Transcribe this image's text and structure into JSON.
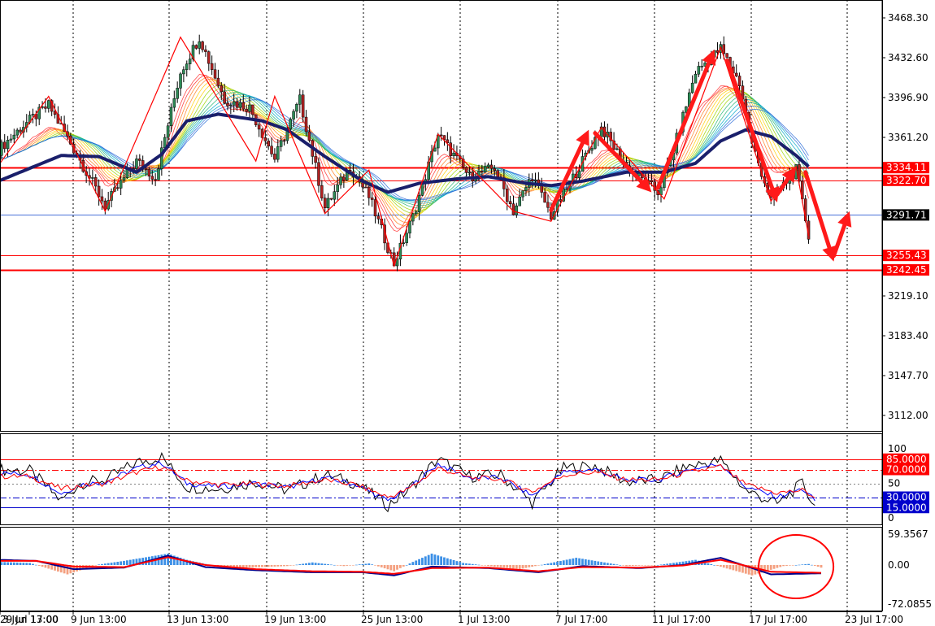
{
  "chart_data": [
    {
      "type": "candlestick",
      "panel": "price",
      "ylim": [
        3095,
        3480
      ],
      "yticks": [
        3468.3,
        3432.6,
        3396.9,
        3361.2,
        3325.5,
        3289.8,
        3254.1,
        3219.1,
        3183.4,
        3147.7,
        3112.0
      ],
      "ytick_labels": [
        "3468.30",
        "3432.60",
        "3396.90",
        "3361.20",
        "",
        "",
        "",
        "3219.10",
        "3183.40",
        "3147.70",
        "3112.00"
      ],
      "x_labels": [
        "3 Jun 13:00",
        "9 Jun 13:00",
        "13 Jun 13:00",
        "19 Jun 13:00",
        "25 Jun 13:00",
        "1 Jul 13:00",
        "7 Jul 17:00",
        "11 Jul 17:00",
        "17 Jul 17:00",
        "23 Jul 17:00",
        "29 Jul 17:00"
      ],
      "price_path": {
        "index": [
          0,
          8,
          16,
          22,
          34,
          44,
          50,
          58,
          64,
          72,
          80,
          88,
          96,
          104,
          112,
          118,
          126,
          132,
          140,
          150,
          158,
          164,
          170,
          176,
          184,
          192,
          200,
          210,
          214,
          222,
          230,
          236,
          240,
          246,
          254,
          258
        ],
        "price": [
          3350,
          3372,
          3390,
          3361,
          3300,
          3340,
          3325,
          3420,
          3451,
          3395,
          3388,
          3342,
          3395,
          3298,
          3335,
          3308,
          3248,
          3290,
          3364,
          3326,
          3334,
          3295,
          3327,
          3291,
          3330,
          3370,
          3335,
          3312,
          3340,
          3420,
          3441,
          3410,
          3355,
          3305,
          3332,
          3273
        ]
      },
      "moving_average": {
        "name": "",
        "index": [
          0,
          20,
          32,
          44,
          52,
          60,
          70,
          84,
          92,
          104,
          116,
          124,
          134,
          146,
          156,
          168,
          176,
          186,
          200,
          212,
          222,
          230,
          238,
          246,
          254,
          258
        ],
        "price": [
          3322,
          3345,
          3344,
          3330,
          3346,
          3376,
          3382,
          3376,
          3368,
          3344,
          3322,
          3312,
          3320,
          3324,
          3326,
          3320,
          3318,
          3322,
          3330,
          3330,
          3338,
          3358,
          3368,
          3362,
          3345,
          3335
        ]
      },
      "horizontal_levels": [
        {
          "value": 3334.11,
          "label": "3334.11",
          "color": "#ff0000",
          "style": "solid-thick"
        },
        {
          "value": 3322.7,
          "label": "3322.70",
          "color": "#ff0000",
          "style": "solid"
        },
        {
          "value": 3291.71,
          "label": "3291.71",
          "color": "#4a72d8",
          "style": "bid"
        },
        {
          "value": 3255.43,
          "label": "3255.43",
          "color": "#ff0000",
          "style": "solid"
        },
        {
          "value": 3242.45,
          "label": "3242.45",
          "color": "#ff0000",
          "style": "solid-thick"
        }
      ],
      "zigzag": {
        "color": "#ff0000",
        "index": [
          0,
          16,
          34,
          58,
          82,
          88,
          104,
          118,
          126,
          140,
          164,
          176,
          192,
          212,
          230,
          246,
          254,
          258
        ],
        "price": [
          3336,
          3398,
          3295,
          3451,
          3340,
          3398,
          3293,
          3332,
          3246,
          3364,
          3295,
          3286,
          3370,
          3306,
          3442,
          3304,
          3335,
          3273
        ]
      },
      "arrows": [
        {
          "from_index": 176,
          "from_price": 3296,
          "to_index": 188,
          "to_price": 3368
        },
        {
          "from_index": 190,
          "from_price": 3365,
          "to_index": 208,
          "to_price": 3312
        },
        {
          "from_index": 210,
          "from_price": 3316,
          "to_index": 228,
          "to_price": 3440
        },
        {
          "from_index": 232,
          "from_price": 3430,
          "to_index": 248,
          "to_price": 3303
        },
        {
          "from_index": 248,
          "from_price": 3310,
          "to_index": 254,
          "to_price": 3335
        },
        {
          "from_index": 257,
          "from_price": 3330,
          "to_index": 266,
          "to_price": 3250
        },
        {
          "from_index": 266,
          "from_price": 3255,
          "to_index": 271,
          "to_price": 3295
        }
      ],
      "colors": {
        "bull": "#2e8b57",
        "bear": "#b22222",
        "ma": "#1a1f6b",
        "level": "#ff0000",
        "bid": "#4a72d8",
        "ribbon": [
          "#ff2a2a",
          "#ff7a1a",
          "#ffcc00",
          "#9ad400",
          "#22b573",
          "#00a6c8",
          "#2a6cd8"
        ]
      }
    },
    {
      "type": "line",
      "panel": "oscillator",
      "ylim": [
        0,
        100
      ],
      "ytick_labels": [
        "100",
        "50",
        "0"
      ],
      "levels": [
        {
          "value": 85,
          "label": "85.0000",
          "color": "#ff0000",
          "style": "solid"
        },
        {
          "value": 70,
          "label": "70.0000",
          "color": "#ff0000",
          "style": "dashdot"
        },
        {
          "value": 50,
          "label": "",
          "color": "#808080",
          "style": "dotted"
        },
        {
          "value": 30,
          "label": "30.0000",
          "color": "#0000cc",
          "style": "dashdot"
        },
        {
          "value": 15,
          "label": "15.0000",
          "color": "#0000cc",
          "style": "solid"
        }
      ],
      "series": [
        {
          "color": "#000000",
          "index": [
            0,
            10,
            20,
            26,
            34,
            44,
            52,
            60,
            70,
            82,
            92,
            104,
            114,
            124,
            130,
            140,
            150,
            160,
            170,
            180,
            190,
            200,
            210,
            220,
            230,
            238,
            248,
            256,
            260
          ],
          "values": [
            70,
            68,
            25,
            50,
            55,
            80,
            88,
            45,
            42,
            52,
            40,
            62,
            50,
            18,
            38,
            85,
            60,
            62,
            22,
            72,
            75,
            52,
            55,
            75,
            83,
            40,
            20,
            50,
            16
          ]
        },
        {
          "color": "#0000ff",
          "index": [
            0,
            10,
            20,
            26,
            34,
            44,
            52,
            60,
            70,
            82,
            92,
            104,
            114,
            124,
            130,
            140,
            150,
            160,
            170,
            180,
            190,
            200,
            210,
            220,
            230,
            238,
            248,
            256,
            260
          ],
          "values": [
            65,
            63,
            35,
            48,
            52,
            72,
            80,
            50,
            45,
            50,
            44,
            58,
            48,
            25,
            40,
            78,
            58,
            58,
            32,
            66,
            70,
            54,
            55,
            70,
            78,
            45,
            30,
            42,
            25
          ]
        },
        {
          "color": "#ff0000",
          "index": [
            0,
            10,
            20,
            26,
            34,
            44,
            52,
            60,
            70,
            82,
            92,
            104,
            114,
            124,
            130,
            140,
            150,
            160,
            170,
            180,
            190,
            200,
            210,
            220,
            230,
            238,
            248,
            256,
            260
          ],
          "values": [
            60,
            60,
            42,
            46,
            50,
            66,
            74,
            54,
            48,
            49,
            46,
            55,
            48,
            30,
            40,
            72,
            58,
            56,
            38,
            62,
            66,
            55,
            55,
            66,
            74,
            48,
            36,
            40,
            30
          ]
        }
      ]
    },
    {
      "type": "bar",
      "panel": "macd",
      "ylim": [
        -72.0855,
        59.3567
      ],
      "ytick_labels": [
        "59.3567",
        "0.00",
        "-72.0855"
      ],
      "histogram": {
        "index": [
          0,
          10,
          22,
          32,
          40,
          54,
          60,
          72,
          84,
          92,
          100,
          110,
          118,
          126,
          132,
          138,
          148,
          158,
          166,
          176,
          184,
          200,
          210,
          222,
          234,
          240,
          250,
          258,
          262
        ],
        "values": [
          6,
          4,
          -18,
          1,
          8,
          22,
          10,
          -6,
          -4,
          -2,
          5,
          -2,
          3,
          -12,
          6,
          22,
          4,
          -3,
          -8,
          4,
          14,
          -2,
          0,
          10,
          -10,
          -20,
          -2,
          2,
          -5
        ],
        "colors": {
          "positive": "#3b8fe6",
          "negative": "#f4a080"
        }
      },
      "series": [
        {
          "color": "#00008b",
          "index": [
            0,
            12,
            24,
            40,
            54,
            66,
            82,
            100,
            116,
            126,
            138,
            156,
            172,
            186,
            204,
            218,
            230,
            246,
            262
          ],
          "values": [
            10,
            8,
            -8,
            -5,
            18,
            -4,
            -10,
            -14,
            -14,
            -20,
            -3,
            -6,
            -14,
            -2,
            -6,
            0,
            14,
            -18,
            -16
          ]
        },
        {
          "color": "#ff0000",
          "index": [
            0,
            12,
            24,
            40,
            54,
            66,
            82,
            100,
            116,
            126,
            138,
            156,
            172,
            186,
            204,
            218,
            230,
            246,
            262
          ],
          "values": [
            8,
            8,
            -3,
            -4,
            15,
            0,
            -8,
            -12,
            -13,
            -17,
            -6,
            -5,
            -12,
            -4,
            -5,
            -1,
            10,
            -13,
            -15
          ]
        }
      ],
      "annotation": {
        "shape": "ellipse",
        "color": "#ff0000"
      }
    }
  ]
}
